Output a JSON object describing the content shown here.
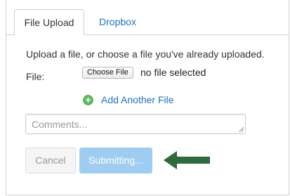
{
  "tabs": [
    {
      "label": "File Upload",
      "active": true
    },
    {
      "label": "Dropbox",
      "active": false
    }
  ],
  "upload": {
    "intro": "Upload a file, or choose a file you've already uploaded.",
    "file_label": "File:",
    "choose_button": "Choose File",
    "no_file": "no file selected",
    "add_another": "Add Another File",
    "add_icon": "plus-circle-icon"
  },
  "comments": {
    "placeholder": "Comments..."
  },
  "actions": {
    "cancel": "Cancel",
    "submit": "Submitting..."
  },
  "colors": {
    "link": "#1e73be",
    "add_icon": "#5cb85c",
    "submit_bg": "#9fcdf2",
    "arrow": "#2e6b3a"
  }
}
